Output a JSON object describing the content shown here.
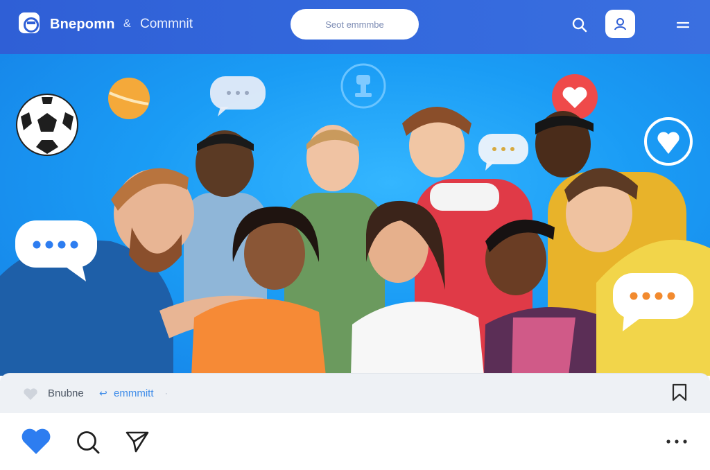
{
  "header": {
    "brand": "Bnepomn",
    "separator": "&",
    "subtitle": "Commnit",
    "search_placeholder": "Seot emmmbe",
    "icons": [
      "logo-icon",
      "search-icon",
      "profile-icon",
      "menu-icon"
    ]
  },
  "hero": {
    "description_free": true,
    "floating_icons": [
      "soccer-ball-icon",
      "basketball-icon",
      "chat-bubble-icon",
      "trophy-icon",
      "heart-icon",
      "heart-circle-icon"
    ]
  },
  "post": {
    "author": "Bnubne",
    "comment_symbol": "↩",
    "comment_label": "emmmitt",
    "caret": "·",
    "icons": [
      "like-icon",
      "comment-icon",
      "share-icon",
      "more-icon",
      "bookmark-icon"
    ]
  },
  "colors": {
    "topbar": "#2f5fd6",
    "hero_bg": "#1a9cf5",
    "like": "#2d7df0",
    "accent_text": "#3d8be8"
  }
}
